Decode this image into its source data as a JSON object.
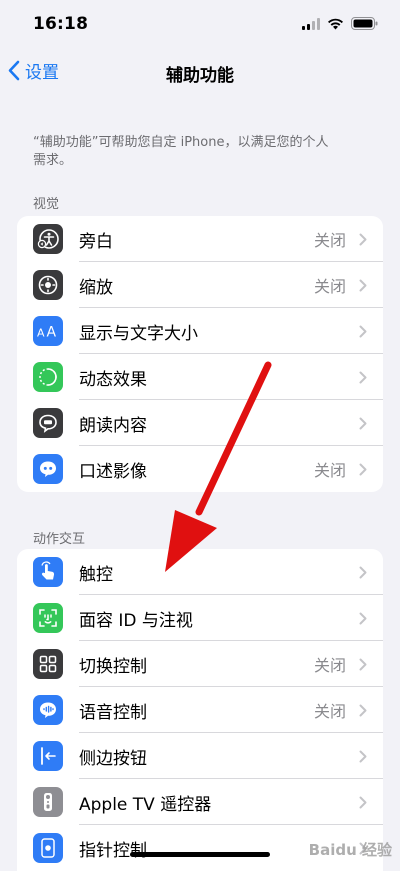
{
  "status_bar": {
    "time": "16:18"
  },
  "nav": {
    "back_label": "设置",
    "title": "辅助功能"
  },
  "intro": "“辅助功能”可帮助您自定 iPhone，以满足您的个人需求。",
  "sections": [
    {
      "header": "视觉",
      "items": [
        {
          "label": "旁白",
          "value": "关闭",
          "icon": "voiceover-icon",
          "icon_color": "#3a3a3c"
        },
        {
          "label": "缩放",
          "value": "关闭",
          "icon": "zoom-icon",
          "icon_color": "#3a3a3c"
        },
        {
          "label": "显示与文字大小",
          "value": "",
          "icon": "text-size-icon",
          "icon_color": "#2f7cf6"
        },
        {
          "label": "动态效果",
          "value": "",
          "icon": "motion-icon",
          "icon_color": "#34c759"
        },
        {
          "label": "朗读内容",
          "value": "",
          "icon": "spoken-content-icon",
          "icon_color": "#3a3a3c"
        },
        {
          "label": "口述影像",
          "value": "关闭",
          "icon": "audio-description-icon",
          "icon_color": "#2f7cf6"
        }
      ]
    },
    {
      "header": "动作交互",
      "items": [
        {
          "label": "触控",
          "value": "",
          "icon": "touch-icon",
          "icon_color": "#2f7cf6"
        },
        {
          "label": "面容 ID 与注视",
          "value": "",
          "icon": "face-id-icon",
          "icon_color": "#34c759"
        },
        {
          "label": "切换控制",
          "value": "关闭",
          "icon": "switch-control-icon",
          "icon_color": "#3a3a3c"
        },
        {
          "label": "语音控制",
          "value": "关闭",
          "icon": "voice-control-icon",
          "icon_color": "#2f7cf6"
        },
        {
          "label": "侧边按钮",
          "value": "",
          "icon": "side-button-icon",
          "icon_color": "#2f7cf6"
        },
        {
          "label": "Apple TV 遥控器",
          "value": "",
          "icon": "apple-tv-remote-icon",
          "icon_color": "#8e8e93"
        },
        {
          "label": "指针控制",
          "value": "",
          "icon": "pointer-control-icon",
          "icon_color": "#2f7cf6"
        }
      ]
    }
  ],
  "colors": {
    "accent": "#1a78f2",
    "annotation_arrow": "#e01010"
  },
  "watermark": "Baidu 经验"
}
